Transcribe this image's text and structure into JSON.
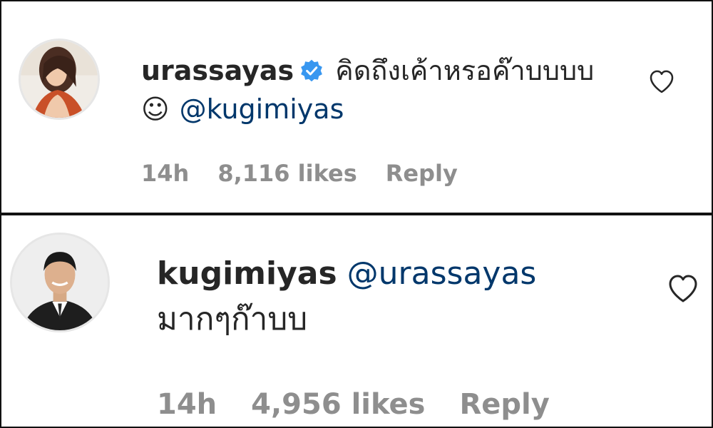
{
  "comments": [
    {
      "username": "urassayas",
      "verified_icon": "verified-badge-icon",
      "text": "คิดถึงเค้าหรอค๊าบบบบ",
      "emoji": "☺",
      "mention": "@kugimiyas",
      "time": "14h",
      "likes": "8,116 likes",
      "reply": "Reply",
      "heart_icon": "heart-outline-icon",
      "colors": {
        "mention": "#00376b",
        "verified": "#3897f0",
        "meta": "#8e8e8e"
      }
    },
    {
      "username": "kugimiyas",
      "mention": "@urassayas",
      "text": "มากๆก๊าบบ",
      "time": "14h",
      "likes": "4,956 likes",
      "reply": "Reply",
      "heart_icon": "heart-outline-icon"
    }
  ]
}
